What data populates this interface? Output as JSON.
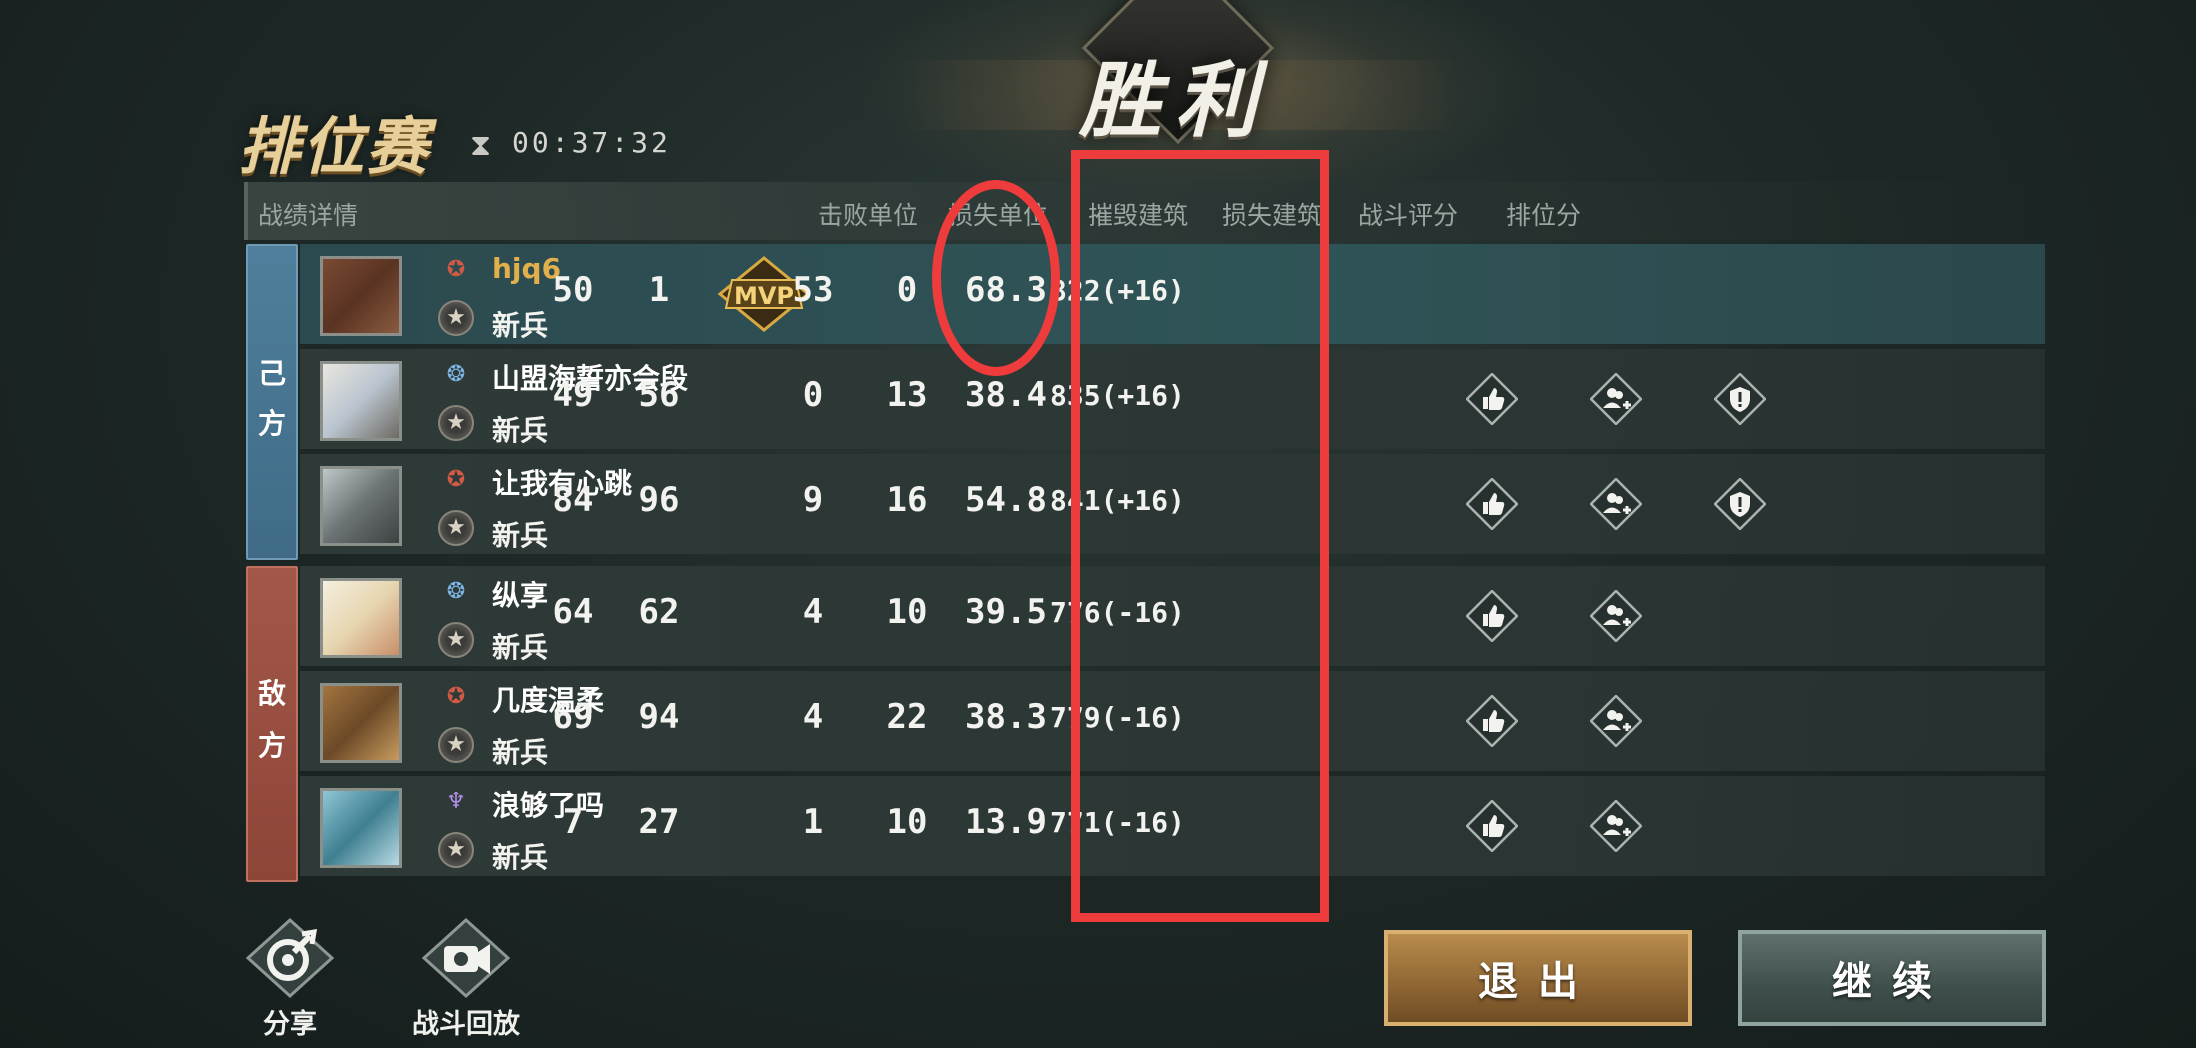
{
  "banner": {
    "result": "胜利"
  },
  "match": {
    "mode": "排位赛",
    "timer_icon": "⧗",
    "time": "00:37:32"
  },
  "headers": {
    "section": "战绩详情",
    "kills": "击败单位",
    "losses": "损失单位",
    "destroyed": "摧毁建筑",
    "lost_buildings": "损失建筑",
    "score": "战斗评分",
    "rank_points": "排位分"
  },
  "sides": {
    "ally": [
      "己",
      "方"
    ],
    "enemy": [
      "敌",
      "方"
    ]
  },
  "mvp_label": "MVP",
  "players": [
    {
      "name": "hjq6",
      "rank": "新兵",
      "kills": "50",
      "losses": "1",
      "destroyed": "53",
      "lost": "0",
      "score": "68.3",
      "points": "822(+16)",
      "badge": "red",
      "mvp": true,
      "actions": []
    },
    {
      "name": "山盟海誓亦会段",
      "rank": "新兵",
      "kills": "49",
      "losses": "56",
      "destroyed": "0",
      "lost": "13",
      "score": "38.4",
      "points": "835(+16)",
      "badge": "blue",
      "mvp": false,
      "actions": [
        "thumbs-up",
        "add-friend",
        "report"
      ]
    },
    {
      "name": "让我有心跳",
      "rank": "新兵",
      "kills": "84",
      "losses": "96",
      "destroyed": "9",
      "lost": "16",
      "score": "54.8",
      "points": "841(+16)",
      "badge": "red",
      "mvp": false,
      "actions": [
        "thumbs-up",
        "add-friend",
        "report"
      ]
    },
    {
      "name": "纵享",
      "rank": "新兵",
      "kills": "64",
      "losses": "62",
      "destroyed": "4",
      "lost": "10",
      "score": "39.5",
      "points": "776(-16)",
      "badge": "blue",
      "mvp": false,
      "actions": [
        "thumbs-up",
        "add-friend"
      ]
    },
    {
      "name": "几度温柔",
      "rank": "新兵",
      "kills": "69",
      "losses": "94",
      "destroyed": "4",
      "lost": "22",
      "score": "38.3",
      "points": "779(-16)",
      "badge": "red",
      "mvp": false,
      "actions": [
        "thumbs-up",
        "add-friend"
      ]
    },
    {
      "name": "浪够了吗",
      "rank": "新兵",
      "kills": "7",
      "losses": "27",
      "destroyed": "1",
      "lost": "10",
      "score": "13.9",
      "points": "771(-16)",
      "badge": "purple",
      "mvp": false,
      "actions": [
        "thumbs-up",
        "add-friend"
      ]
    }
  ],
  "bottom": {
    "share": "分享",
    "replay": "战斗回放",
    "exit": "退出",
    "continue": "继续"
  },
  "annotation_color": "#ee3b3b"
}
